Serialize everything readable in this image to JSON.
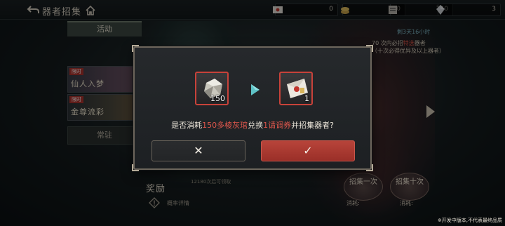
{
  "topbar": {
    "title": "器者招集",
    "back_icon": "back-arrow-icon",
    "home_icon": "home-icon",
    "resources": [
      {
        "icon": "mail-ticket-icon",
        "value": "0"
      },
      {
        "icon": "gold-coin-icon",
        "value": "0"
      },
      {
        "icon": "scroll-icon",
        "value": "740"
      },
      {
        "icon": "crystal-icon",
        "value": "3"
      }
    ]
  },
  "sidemenu": {
    "header": "活动",
    "cards": [
      {
        "tag": "限时",
        "name": "仙人入梦"
      },
      {
        "tag": "限时",
        "name": "金尊流彩"
      }
    ],
    "regular": "常驻"
  },
  "background": {
    "countdown": "剩3天16小时",
    "guarantee_pre": "70 次内必招",
    "guarantee_hl": "特选",
    "guarantee_post": "器者",
    "guarantee_line2": "（十次必得优异及以上器者）",
    "reward_label": "奖励",
    "reward_sub": "12180次后可领取",
    "prob_label": "概率详情",
    "pull_one": "招集一次",
    "pull_ten": "招集十次",
    "cost_one": "消耗:",
    "cost_ten": "消耗:",
    "disclaimer": "※开发中版本,不代表最终品质"
  },
  "modal": {
    "from_item": {
      "icon": "polished-crystal-icon",
      "qty": "150"
    },
    "to_item": {
      "icon": "invitation-envelope-icon",
      "qty": "1"
    },
    "arrow_icon": "play-arrow-icon",
    "question_pre": "是否消耗",
    "question_hl1": "150多棱灰琯",
    "question_mid": "兑换",
    "question_hl2": "1请调券",
    "question_post": "并招集器者?",
    "cancel_glyph": "✕",
    "confirm_glyph": "✓",
    "colors": {
      "accent": "#c8423a",
      "highlight": "#e0574c"
    }
  }
}
